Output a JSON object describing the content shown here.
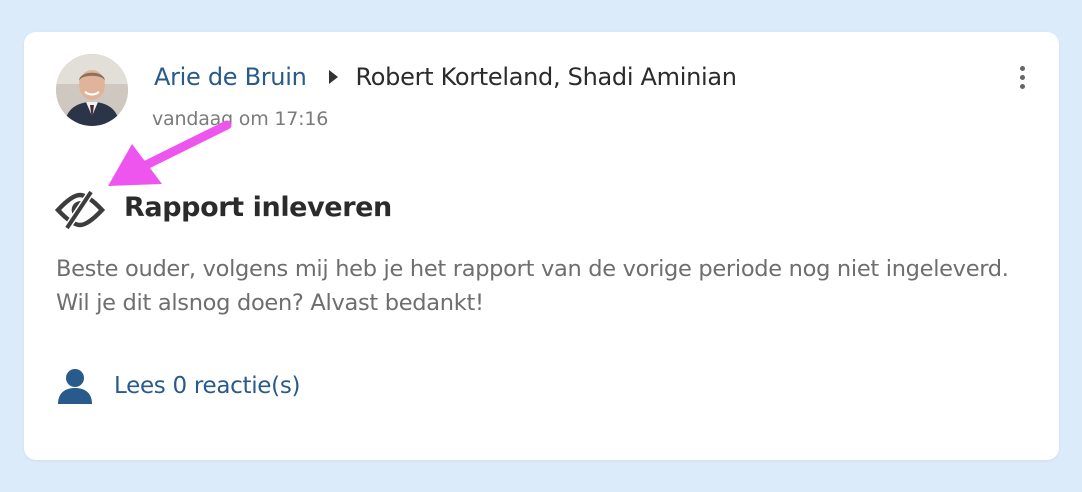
{
  "post": {
    "author": "Arie de Bruin",
    "recipients": "Robert Korteland, Shadi Aminian",
    "timestamp": "vandaag om 17:16",
    "title": "Rapport inleveren",
    "body": "Beste ouder, volgens mij heb je het rapport van de vorige periode nog niet ingeleverd. Wil je dit alsnog doen? Alvast bedankt!",
    "comments_label": "Lees 0 reactie(s)"
  },
  "icons": {
    "options": "more-vertical-icon",
    "visibility": "eye-slash-icon",
    "comments": "user-icon",
    "separator": "caret-right-icon"
  },
  "colors": {
    "background": "#dcebfa",
    "card": "#ffffff",
    "link": "#285a8c",
    "annotation_arrow": "#ee55ee",
    "text_dark": "#2b2b2b",
    "text_muted": "#6e6e6e"
  }
}
